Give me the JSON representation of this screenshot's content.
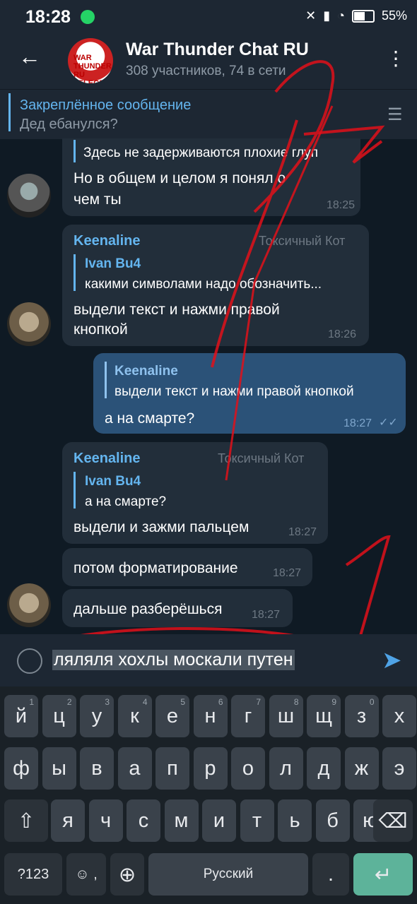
{
  "status": {
    "time": "18:28",
    "battery": "55%"
  },
  "header": {
    "back_icon": "arrow-left-icon",
    "avatar_text": "WAR THUNDER RU TELEGRAM",
    "title": "War Thunder Chat RU",
    "subtitle": "308 участников, 74 в сети",
    "menu_icon": "more-vert-icon"
  },
  "pinned": {
    "title": "Закреплённое сообщение",
    "text": "Дед ебанулся?"
  },
  "messages": [
    {
      "reply_text": "Здесь не задерживаются плохие глуп",
      "text1": "Но в общем и целом я понял о",
      "text2": "чем ты",
      "time": "18:25"
    },
    {
      "name": "Keenaline",
      "title": "Токсичный Кот",
      "reply_name": "Ivan Bu4",
      "reply_text": "какими символами надо обозначить...",
      "text1": "выдели текст и нажми правой",
      "text2": "кнопкой",
      "time": "18:26"
    },
    {
      "reply_name": "Keenaline",
      "reply_text": "выдели текст и нажми правой кнопкой",
      "text": "а на смарте?",
      "time": "18:27"
    },
    {
      "name": "Keenaline",
      "title": "Токсичный Кот",
      "reply_name": "Ivan Bu4",
      "reply_text": "а на смарте?",
      "text": "выдели и зажми пальцем",
      "time": "18:27"
    },
    {
      "text": "потом форматирование",
      "time": "18:27"
    },
    {
      "text": "дальше разберёшься",
      "time": "18:27"
    }
  ],
  "input": {
    "text": "ляляля хохлы москали путен",
    "emoji_icon": "emoji-icon",
    "send_icon": "send-icon"
  },
  "keyboard": {
    "row1": [
      [
        "й",
        "1"
      ],
      [
        "ц",
        "2"
      ],
      [
        "у",
        "3"
      ],
      [
        "к",
        "4"
      ],
      [
        "е",
        "5"
      ],
      [
        "н",
        "6"
      ],
      [
        "г",
        "7"
      ],
      [
        "ш",
        "8"
      ],
      [
        "щ",
        "9"
      ],
      [
        "з",
        "0"
      ],
      [
        "х",
        ""
      ]
    ],
    "row2": [
      "ф",
      "ы",
      "в",
      "а",
      "п",
      "р",
      "о",
      "л",
      "д",
      "ж",
      "э"
    ],
    "row3": [
      "я",
      "ч",
      "с",
      "м",
      "и",
      "т",
      "ь",
      "б",
      "ю"
    ],
    "sym": "?123",
    "emoji_key": "☺",
    "comma": ",",
    "space": "Русский",
    "dot": ".",
    "shift_icon": "shift-icon",
    "backspace_icon": "backspace-icon",
    "globe_icon": "globe-icon",
    "enter_icon": "enter-icon"
  }
}
